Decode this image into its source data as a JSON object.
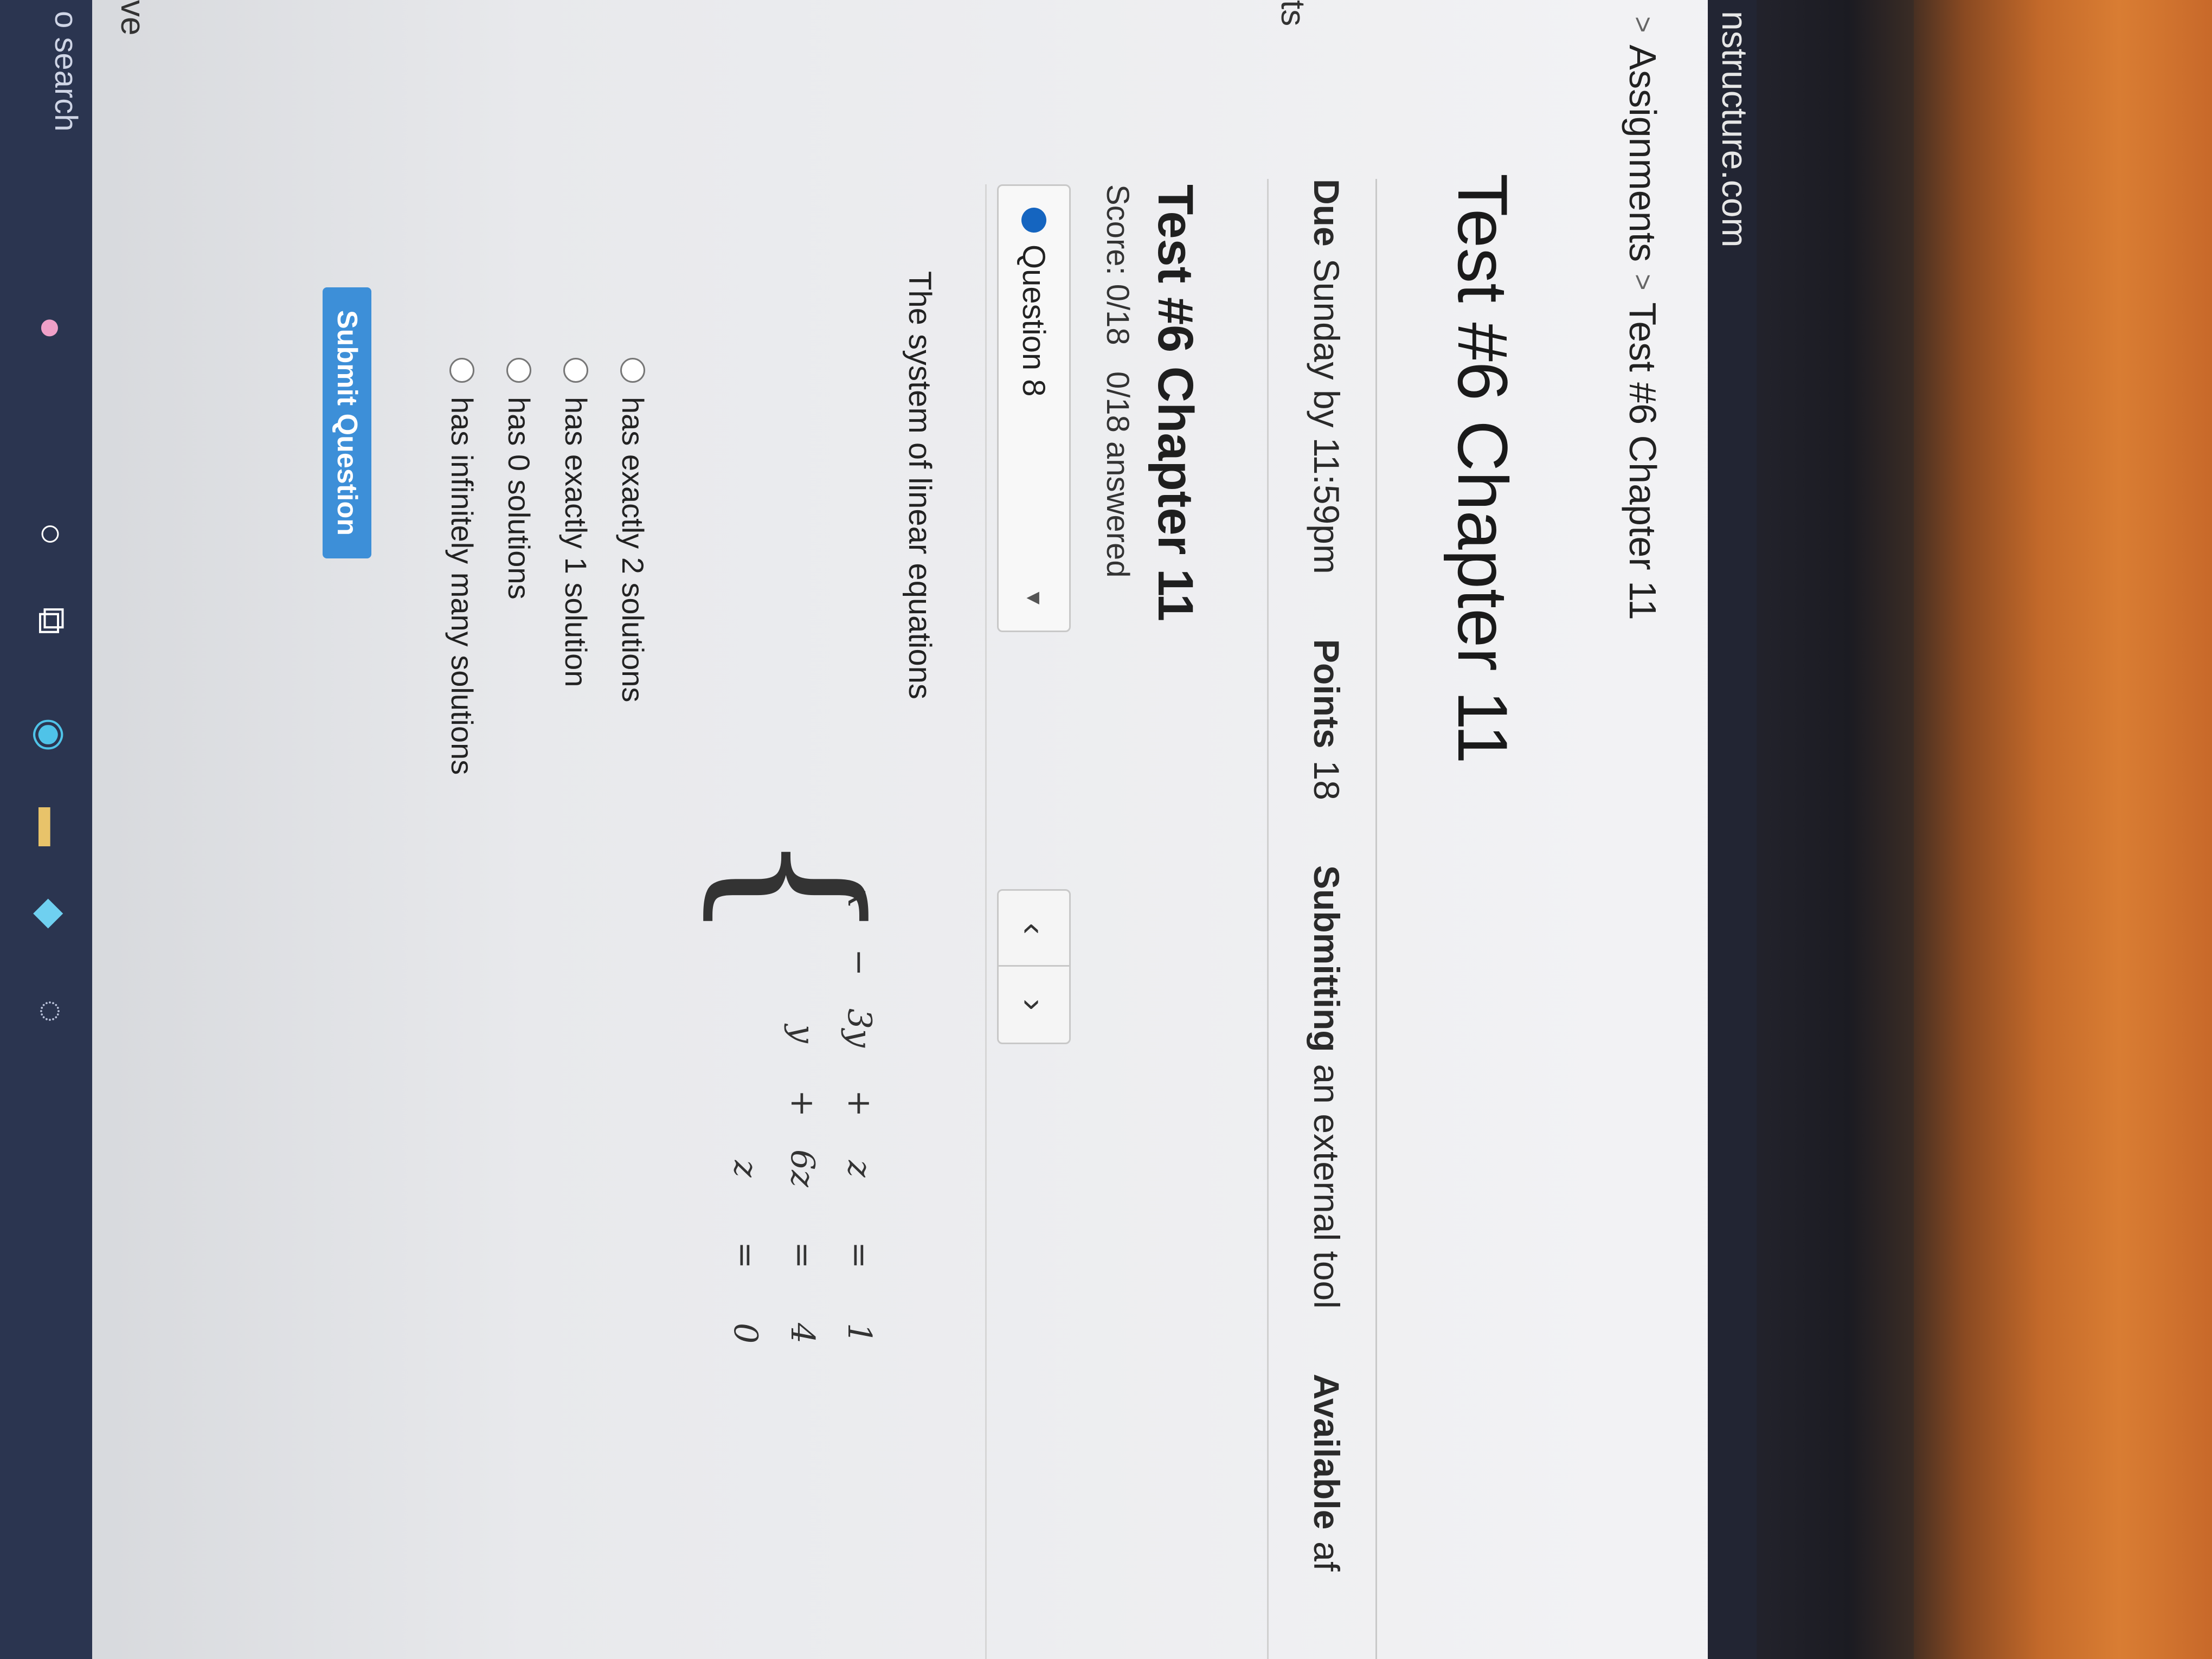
{
  "browser": {
    "url": "nstructure.com"
  },
  "breadcrumb": {
    "items": [
      "Assignments",
      "Test #6 Chapter 11"
    ],
    "separator": ">"
  },
  "nav_edge": {
    "top_fragment": "ts",
    "bottom_fragment": "ve"
  },
  "assignment": {
    "title": "Test #6 Chapter 11",
    "due_label": "Due",
    "due_value": "Sunday by 11:59pm",
    "points_label": "Points",
    "points_value": "18",
    "submitting_label": "Submitting",
    "submitting_value": "an external tool",
    "available_label": "Available",
    "available_value": "af"
  },
  "quiz": {
    "title": "Test #6 Chapter 11",
    "score": "Score: 0/18",
    "answered": "0/18 answered",
    "question_selector": "Question 8",
    "prev_icon": "‹",
    "next_icon": "›"
  },
  "question": {
    "prompt": "The system of linear equations",
    "equations": [
      {
        "c1": "x",
        "o1": "−",
        "c2": "3y",
        "o2": "+",
        "c3": "z",
        "eq": "=",
        "rhs": "1"
      },
      {
        "c1": "",
        "o1": "",
        "c2": "y",
        "o2": "+",
        "c3": "6z",
        "eq": "=",
        "rhs": "4"
      },
      {
        "c1": "",
        "o1": "",
        "c2": "",
        "o2": "",
        "c3": "z",
        "eq": "=",
        "rhs": "0"
      }
    ],
    "answers": [
      "has exactly 2 solutions",
      "has exactly 1 solution",
      "has 0 solutions",
      "has infinitely many solutions"
    ],
    "submit_label": "Submit Question"
  },
  "taskbar": {
    "search_text": "o search",
    "icons": [
      "apps-icon",
      "cortana-icon",
      "task-view-icon",
      "edge-icon",
      "file-explorer-icon",
      "store-icon",
      "misc-icon"
    ]
  }
}
